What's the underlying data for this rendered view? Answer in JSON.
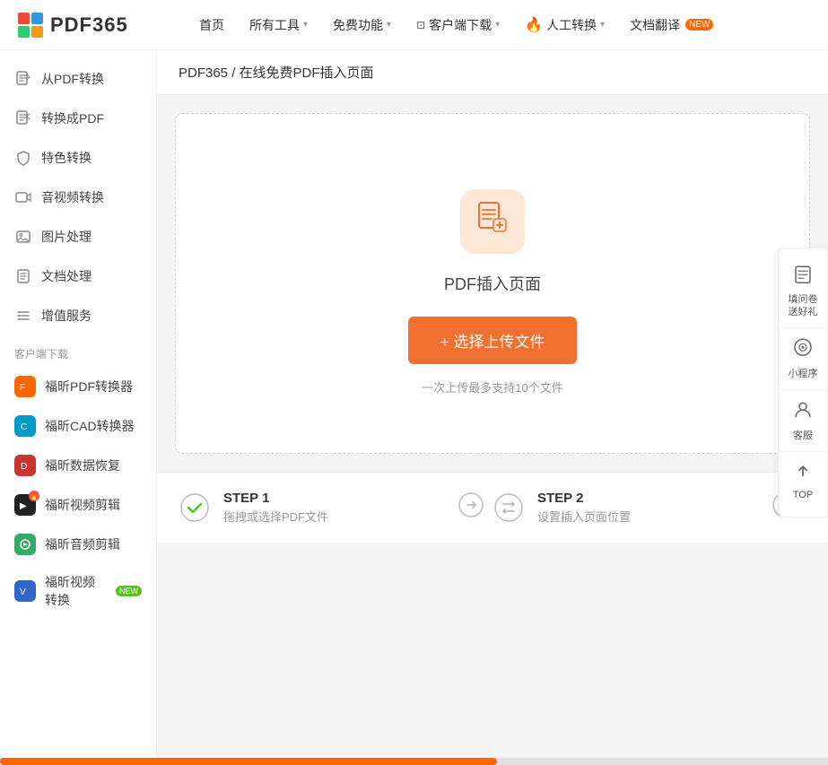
{
  "logo": {
    "text": "PDF365",
    "colors": [
      "#e74c3c",
      "#3498db",
      "#2ecc71",
      "#f39c12"
    ]
  },
  "nav": {
    "items": [
      {
        "label": "首页",
        "hasChevron": false
      },
      {
        "label": "所有工具",
        "hasChevron": true
      },
      {
        "label": "免费功能",
        "hasChevron": true
      },
      {
        "label": "客户端下载",
        "hasChevron": true,
        "hasIcon": true
      },
      {
        "label": "人工转换",
        "hasChevron": true,
        "hasFire": true
      },
      {
        "label": "文档翻译",
        "hasChevron": false,
        "hasBadge": true,
        "badge": "NEW"
      }
    ]
  },
  "sidebar": {
    "main_items": [
      {
        "label": "从PDF转换",
        "icon": "📄"
      },
      {
        "label": "转换成PDF",
        "icon": "📋"
      },
      {
        "label": "特色转换",
        "icon": "🛡"
      },
      {
        "label": "音视频转换",
        "icon": "🎬"
      },
      {
        "label": "图片处理",
        "icon": "🖼"
      },
      {
        "label": "文档处理",
        "icon": "📝"
      },
      {
        "label": "增值服务",
        "icon": "☰"
      }
    ],
    "client_title": "客户端下载",
    "client_items": [
      {
        "label": "福昕PDF转换器",
        "bg": "#ff6600",
        "icon": "F"
      },
      {
        "label": "福昕CAD转换器",
        "bg": "#0099cc",
        "icon": "C"
      },
      {
        "label": "福昕数据恢复",
        "bg": "#cc3333",
        "icon": "D"
      },
      {
        "label": "福昕视频剪辑",
        "bg": "#222",
        "icon": "V",
        "hasBadge": true
      },
      {
        "label": "福昕音频剪辑",
        "bg": "#33aa66",
        "icon": "A"
      },
      {
        "label": "福昕视频转换",
        "bg": "#3366cc",
        "icon": "V2",
        "badge": "NEW"
      }
    ]
  },
  "breadcrumb": "PDF365 / 在线免费PDF插入页面",
  "upload": {
    "icon": "📋",
    "title": "PDF插入页面",
    "button_label": "+ 选择上传文件",
    "hint": "一次上传最多支持10个文件"
  },
  "steps": [
    {
      "label": "STEP 1",
      "desc": "拖拽或选择PDF文件",
      "icon_type": "check"
    },
    {
      "label": "STEP 2",
      "desc": "设置插入页面位置",
      "icon_type": "swap"
    }
  ],
  "right_panel": [
    {
      "label": "填问卷\n送好礼",
      "icon": "📋"
    },
    {
      "label": "小程序",
      "icon": "⊙"
    },
    {
      "label": "客服",
      "icon": "👤"
    },
    {
      "label": "TOP",
      "icon": "↑"
    }
  ]
}
